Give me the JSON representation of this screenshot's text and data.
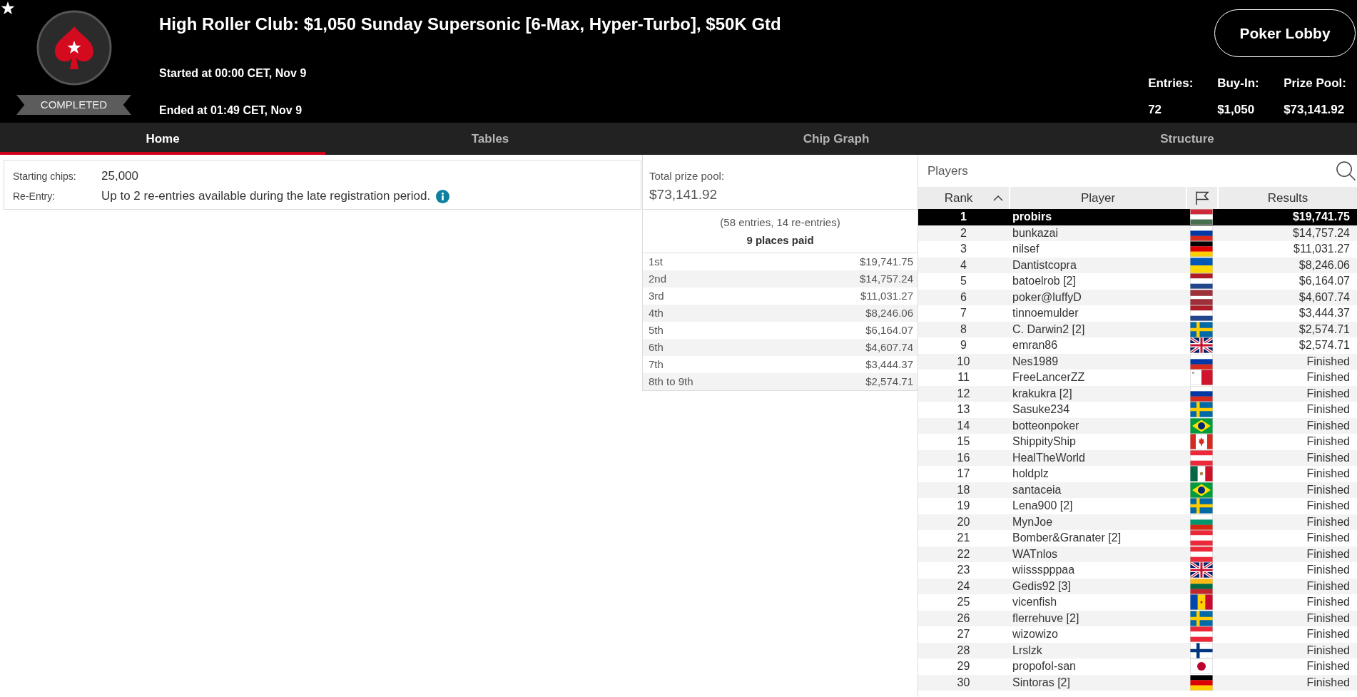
{
  "header": {
    "favorite": true,
    "status": "COMPLETED",
    "title": "High Roller Club: $1,050 Sunday Supersonic [6-Max, Hyper-Turbo], $50K Gtd",
    "started": "Started at 00:00 CET, Nov 9",
    "ended": "Ended at 01:49 CET, Nov 9",
    "lobby_button": "Poker Lobby",
    "stats": [
      {
        "label": "Entries:",
        "value": "72"
      },
      {
        "label": "Buy-In:",
        "value": "$1,050"
      },
      {
        "label": "Prize Pool:",
        "value": "$73,141.92"
      }
    ]
  },
  "tabs": [
    {
      "label": "Home",
      "selected": true
    },
    {
      "label": "Tables",
      "selected": false
    },
    {
      "label": "Chip Graph",
      "selected": false
    },
    {
      "label": "Structure",
      "selected": false
    }
  ],
  "details": [
    {
      "label": "Starting chips:",
      "value": "25,000",
      "info": false
    },
    {
      "label": "Re-Entry:",
      "value": "Up to 2 re-entries available during the late registration period.",
      "info": true
    }
  ],
  "prizes": {
    "label": "Total prize pool:",
    "total": "$73,141.92",
    "entries": "(58 entries, 14 re-entries)",
    "places_paid": "9 places paid",
    "rows": [
      {
        "place": "1st",
        "amount": "$19,741.75"
      },
      {
        "place": "2nd",
        "amount": "$14,757.24"
      },
      {
        "place": "3rd",
        "amount": "$11,031.27"
      },
      {
        "place": "4th",
        "amount": "$8,246.06"
      },
      {
        "place": "5th",
        "amount": "$6,164.07"
      },
      {
        "place": "6th",
        "amount": "$4,607.74"
      },
      {
        "place": "7th",
        "amount": "$3,444.37"
      },
      {
        "place": "8th to 9th",
        "amount": "$2,574.71"
      }
    ]
  },
  "players": {
    "title": "Players",
    "columns": [
      {
        "kind": "text",
        "label": "Rank",
        "sorted": true
      },
      {
        "kind": "text",
        "label": "Player",
        "sorted": false
      },
      {
        "kind": "flag"
      },
      {
        "kind": "text",
        "label": "Results",
        "sorted": false
      }
    ],
    "rows": [
      {
        "rank": "1",
        "name": "probirs",
        "flag": {
          "kind": "hungary"
        },
        "result": "$19,741.75",
        "selected": true
      },
      {
        "rank": "2",
        "name": "bunkazai",
        "flag": {
          "kind": "russia"
        },
        "result": "$14,757.24",
        "selected": false
      },
      {
        "rank": "3",
        "name": "nilsef",
        "flag": {
          "kind": "germany"
        },
        "result": "$11,031.27",
        "selected": false
      },
      {
        "rank": "4",
        "name": "Dantistcopra",
        "flag": {
          "kind": "ukraine"
        },
        "result": "$8,246.06",
        "selected": false
      },
      {
        "rank": "5",
        "name": "batoelrob [2]",
        "flag": {
          "kind": "netherlands"
        },
        "result": "$6,164.07",
        "selected": false
      },
      {
        "rank": "6",
        "name": "poker@luffyD",
        "flag": {
          "kind": "latvia"
        },
        "result": "$4,607.74",
        "selected": false
      },
      {
        "rank": "7",
        "name": "tinnoemulder",
        "flag": {
          "kind": "netherlands"
        },
        "result": "$3,444.37",
        "selected": false
      },
      {
        "rank": "8",
        "name": "C. Darwin2 [2]",
        "flag": {
          "kind": "sweden"
        },
        "result": "$2,574.71",
        "selected": false
      },
      {
        "rank": "9",
        "name": "emran86",
        "flag": {
          "kind": "uk"
        },
        "result": "$2,574.71",
        "selected": false
      },
      {
        "rank": "10",
        "name": "Nes1989",
        "flag": {
          "kind": "russia"
        },
        "result": "Finished",
        "selected": false
      },
      {
        "rank": "11",
        "name": "FreeLancerZZ",
        "flag": {
          "kind": "malta"
        },
        "result": "Finished",
        "selected": false
      },
      {
        "rank": "12",
        "name": "krakukra [2]",
        "flag": {
          "kind": "russia"
        },
        "result": "Finished",
        "selected": false
      },
      {
        "rank": "13",
        "name": "Sasuke234",
        "flag": {
          "kind": "sweden"
        },
        "result": "Finished",
        "selected": false
      },
      {
        "rank": "14",
        "name": "botteonpoker",
        "flag": {
          "kind": "brazil"
        },
        "result": "Finished",
        "selected": false
      },
      {
        "rank": "15",
        "name": "ShippityShip",
        "flag": {
          "kind": "canada"
        },
        "result": "Finished",
        "selected": false
      },
      {
        "rank": "16",
        "name": "HealTheWorld",
        "flag": {
          "kind": "austria"
        },
        "result": "Finished",
        "selected": false
      },
      {
        "rank": "17",
        "name": "holdplz",
        "flag": {
          "kind": "mexico"
        },
        "result": "Finished",
        "selected": false
      },
      {
        "rank": "18",
        "name": "santaceia",
        "flag": {
          "kind": "brazil"
        },
        "result": "Finished",
        "selected": false
      },
      {
        "rank": "19",
        "name": "Lena900 [2]",
        "flag": {
          "kind": "sweden"
        },
        "result": "Finished",
        "selected": false
      },
      {
        "rank": "20",
        "name": "MynJoe",
        "flag": {
          "kind": "bulgaria"
        },
        "result": "Finished",
        "selected": false
      },
      {
        "rank": "21",
        "name": "Bomber&Granater [2]",
        "flag": {
          "kind": "austria"
        },
        "result": "Finished",
        "selected": false
      },
      {
        "rank": "22",
        "name": "WATnlos",
        "flag": {
          "kind": "austria"
        },
        "result": "Finished",
        "selected": false
      },
      {
        "rank": "23",
        "name": "wiissspppaa",
        "flag": {
          "kind": "uk"
        },
        "result": "Finished",
        "selected": false
      },
      {
        "rank": "24",
        "name": "Gedis92 [3]",
        "flag": {
          "kind": "lithuania"
        },
        "result": "Finished",
        "selected": false
      },
      {
        "rank": "25",
        "name": "vicenfish",
        "flag": {
          "kind": "moldova"
        },
        "result": "Finished",
        "selected": false
      },
      {
        "rank": "26",
        "name": "flerrehuve [2]",
        "flag": {
          "kind": "sweden"
        },
        "result": "Finished",
        "selected": false
      },
      {
        "rank": "27",
        "name": "wizowizo",
        "flag": {
          "kind": "austria"
        },
        "result": "Finished",
        "selected": false
      },
      {
        "rank": "28",
        "name": "Lrslzk",
        "flag": {
          "kind": "finland"
        },
        "result": "Finished",
        "selected": false
      },
      {
        "rank": "29",
        "name": "propofol-san",
        "flag": {
          "kind": "japan"
        },
        "result": "Finished",
        "selected": false
      },
      {
        "rank": "30",
        "name": "Sintoras [2]",
        "flag": {
          "kind": "germany"
        },
        "result": "Finished",
        "selected": false
      }
    ]
  }
}
